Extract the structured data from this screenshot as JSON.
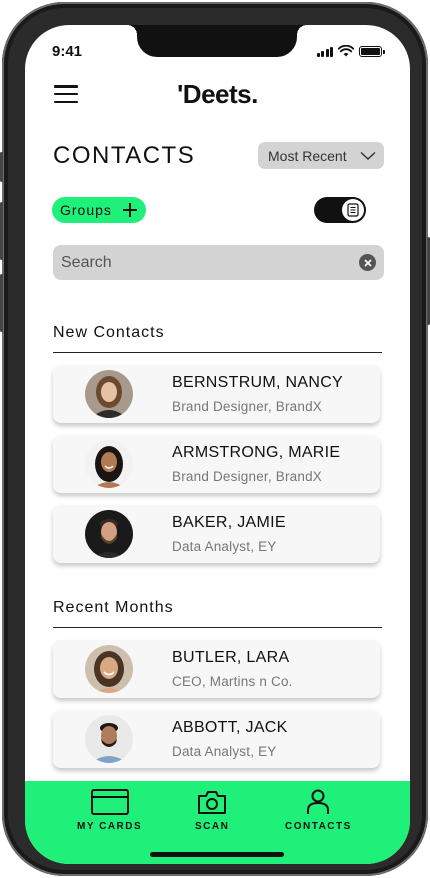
{
  "status": {
    "time": "9:41"
  },
  "header": {
    "logo": "'Deets."
  },
  "page": {
    "title": "CONTACTS",
    "sort": "Most Recent",
    "groups_label": "Groups"
  },
  "search": {
    "placeholder": "Search",
    "value": ""
  },
  "sections": {
    "new": {
      "title": "New Contacts",
      "contacts": [
        {
          "name": "BERNSTRUM, NANCY",
          "role": "Brand Designer, BrandX"
        },
        {
          "name": "ARMSTRONG, MARIE",
          "role": "Brand Designer, BrandX"
        },
        {
          "name": "BAKER, JAMIE",
          "role": "Data Analyst, EY"
        }
      ]
    },
    "recent": {
      "title": "Recent Months",
      "contacts": [
        {
          "name": "BUTLER, LARA",
          "role": "CEO, Martins n Co."
        },
        {
          "name": "ABBOTT, JACK",
          "role": "Data Analyst, EY"
        }
      ]
    }
  },
  "nav": {
    "my_cards": "MY CARDS",
    "scan": "SCAN",
    "contacts": "CONTACTS"
  },
  "colors": {
    "accent": "#1ff07a",
    "chip": "#d3d3d3"
  },
  "icons": [
    "menu-icon",
    "chevron-down-icon",
    "plus-icon",
    "list-icon",
    "clear-icon",
    "card-icon",
    "camera-icon",
    "person-icon"
  ]
}
